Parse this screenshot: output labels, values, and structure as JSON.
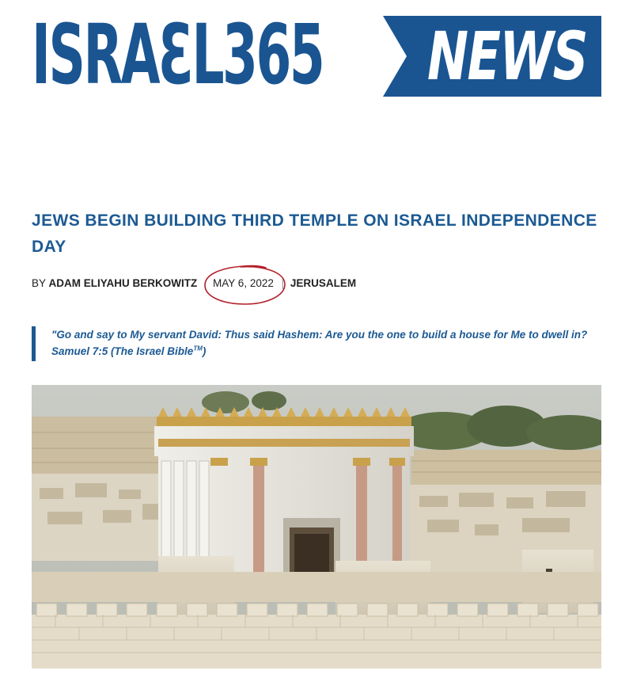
{
  "masthead": {
    "logo_left": "ISRAƐL365",
    "logo_right": "NEWS",
    "brand_color": "#1a5592"
  },
  "article": {
    "headline": "JEWS BEGIN BUILDING THIRD TEMPLE ON ISRAEL INDEPENDENCE DAY",
    "byline": {
      "prefix": "BY",
      "author": "ADAM ELIYAHU BERKOWITZ",
      "date": "MAY 6, 2022",
      "separator": "|",
      "location": "JERUSALEM"
    },
    "quote": {
      "text": "\"Go and say to My servant David: Thus said Hashem: Are you the one to build a house for Me to dwell in? Samuel 7:5 (The Israel Bible",
      "trademark": "TM",
      "closing": ")"
    },
    "accent_color": "#1c5a93",
    "annotation_color": "#b3202a"
  }
}
